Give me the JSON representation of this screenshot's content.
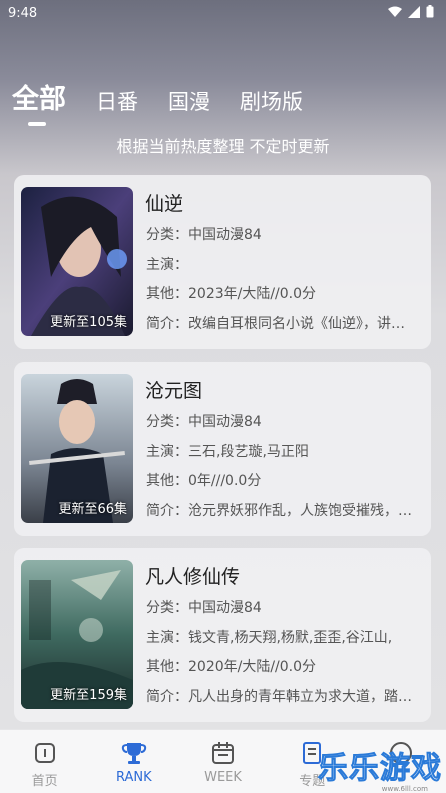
{
  "status": {
    "time": "9:48"
  },
  "tabs": [
    {
      "label": "全部",
      "active": true
    },
    {
      "label": "日番",
      "active": false
    },
    {
      "label": "国漫",
      "active": false
    },
    {
      "label": "剧场版",
      "active": false
    }
  ],
  "subtitle": "根据当前热度整理 不定时更新",
  "cards": [
    {
      "title": "仙逆",
      "badge": "更新至105集",
      "category": "分类：中国动漫84",
      "cast": "主演：",
      "other": "其他：2023年/大陆//0.0分",
      "intro": "简介：改编自耳根同名小说《仙逆》，讲述了乡村平凡少年王林以心中之感动，逆仙而修，求的不仅是长生"
    },
    {
      "title": "沧元图",
      "badge": "更新至66集",
      "category": "分类：中国动漫84",
      "cast": "主演：三石,段艺璇,马正阳",
      "other": "其他：0年///0.0分",
      "intro": "简介：沧元界妖邪作乱，人族饱受摧残，孟川自幼习武修炼"
    },
    {
      "title": "凡人修仙传",
      "badge": "更新至159集",
      "category": "分类：中国动漫84",
      "cast": "主演：钱文青,杨天翔,杨默,歪歪,谷江山,",
      "other": "其他：2020年/大陆//0.0分",
      "intro": "简介：凡人出身的青年韩立为求大道，踏上修仙之路"
    }
  ],
  "nav": [
    {
      "label": "首页",
      "icon": "home-icon",
      "active": false
    },
    {
      "label": "RANK",
      "icon": "trophy-icon",
      "active": true
    },
    {
      "label": "WEEK",
      "icon": "calendar-icon",
      "active": false
    },
    {
      "label": "专题",
      "icon": "topic-icon",
      "active": false
    },
    {
      "label": "",
      "icon": "profile-icon",
      "active": false
    }
  ],
  "watermark": {
    "text": "乐乐游戏",
    "url": "www.6lll.com"
  },
  "colors": {
    "accent": "#2d6bd6",
    "inactive": "#9a9a9a"
  }
}
